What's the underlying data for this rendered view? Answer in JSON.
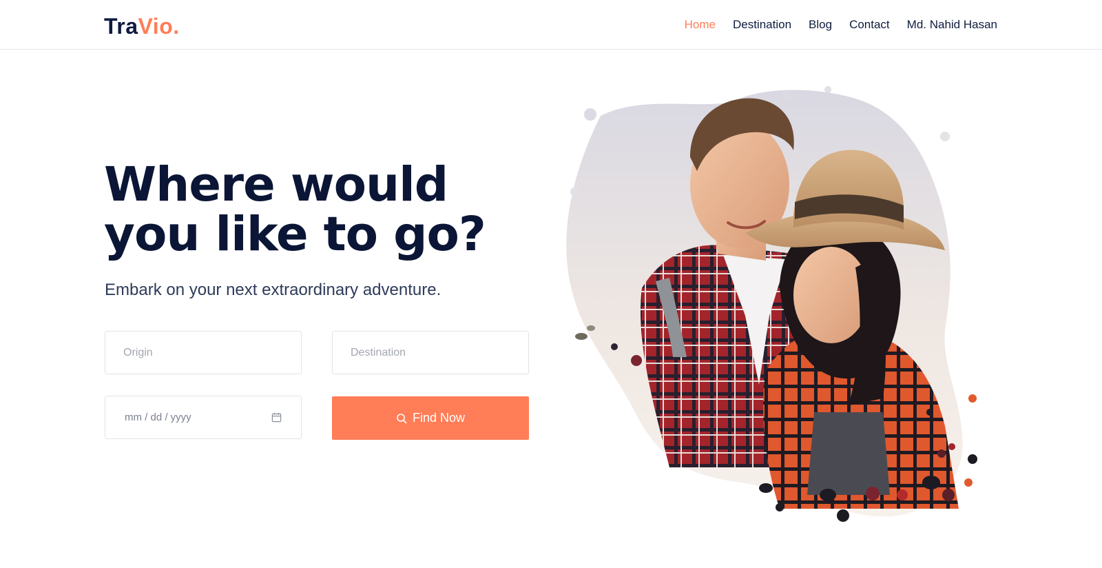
{
  "brand": {
    "part1": "Tra",
    "part2": "Vio."
  },
  "nav": {
    "items": [
      {
        "label": "Home",
        "active": true
      },
      {
        "label": "Destination",
        "active": false
      },
      {
        "label": "Blog",
        "active": false
      },
      {
        "label": "Contact",
        "active": false
      },
      {
        "label": "Md. Nahid Hasan",
        "active": false
      }
    ]
  },
  "hero": {
    "title": "Where would you like to go?",
    "subtitle": "Embark on your next extraordinary adventure."
  },
  "search": {
    "origin_placeholder": "Origin",
    "destination_placeholder": "Destination",
    "date_placeholder": "mm / dd / yyyy",
    "button_label": "Find Now",
    "button_icon": "search-icon"
  },
  "colors": {
    "accent": "#ff7d57",
    "navy": "#0f1c3f",
    "border": "#e1e3e8"
  }
}
